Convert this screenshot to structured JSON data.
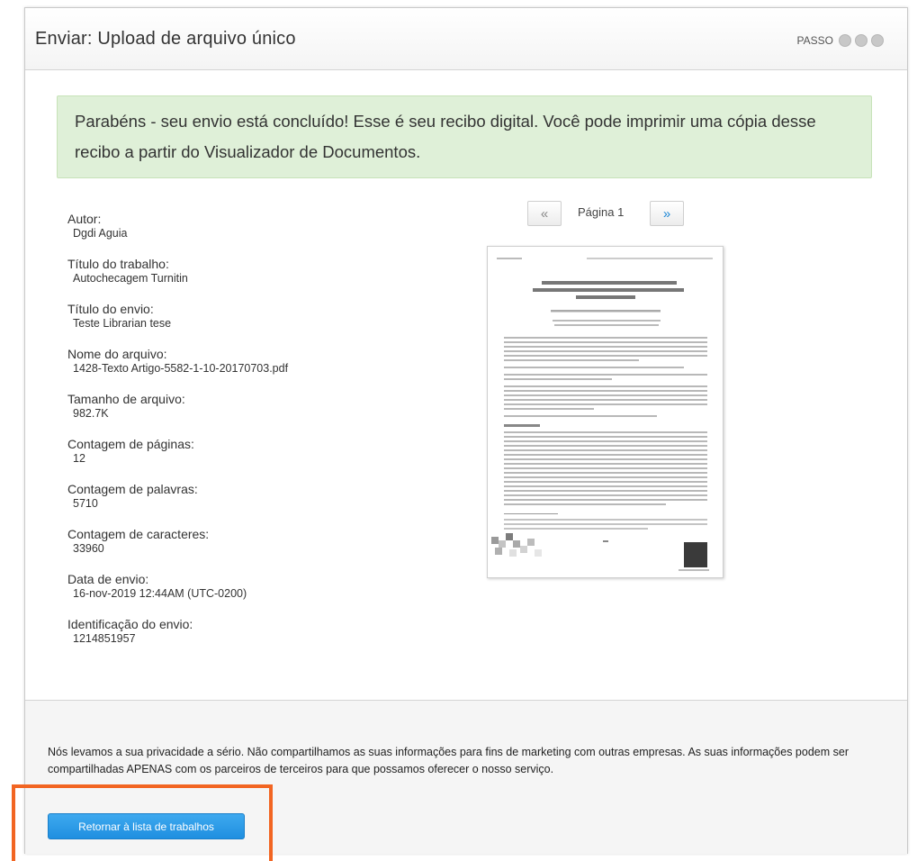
{
  "header": {
    "title": "Enviar: Upload de arquivo único",
    "steps_label": "PASSO"
  },
  "alert": {
    "message": "Parabéns - seu envio está concluído! Esse é seu recibo digital. Você pode imprimir uma cópia desse recibo a partir do Visualizador de Documentos."
  },
  "receipt": [
    {
      "label": "Autor:",
      "value": "Dgdi Aguia"
    },
    {
      "label": "Título do trabalho:",
      "value": "Autochecagem Turnitin"
    },
    {
      "label": "Título do envio:",
      "value": "Teste Librarian tese"
    },
    {
      "label": "Nome do arquivo:",
      "value": "1428-Texto Artigo-5582-1-10-20170703.pdf"
    },
    {
      "label": "Tamanho de arquivo:",
      "value": "982.7K"
    },
    {
      "label": "Contagem de páginas:",
      "value": "12"
    },
    {
      "label": "Contagem de palavras:",
      "value": "5710"
    },
    {
      "label": "Contagem de caracteres:",
      "value": "33960"
    },
    {
      "label": "Data de envio:",
      "value": "16-nov-2019 12:44AM (UTC-0200)"
    },
    {
      "label": "Identificação do envio:",
      "value": "1214851957"
    }
  ],
  "pager": {
    "prev": "«",
    "page_text": "Página 1",
    "next": "»"
  },
  "footer": {
    "privacy_text": "Nós levamos a sua privacidade a sério. Não compartilhamos as suas informações para fins de marketing com outras empresas. As suas informações podem ser compartilhadas APENAS com os parceiros de terceiros para que possamos oferecer o nosso serviço.",
    "return_button": "Retornar à lista de trabalhos"
  },
  "colors": {
    "alert_bg": "#dff0d8",
    "button_bg": "#2a9be8",
    "highlight": "#f26522"
  }
}
